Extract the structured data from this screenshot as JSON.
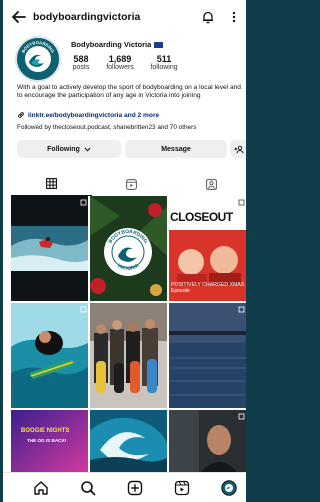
{
  "header": {
    "username": "bodyboardingvictoria",
    "icons": [
      "back-arrow-icon",
      "bell-icon",
      "more-icon"
    ]
  },
  "profile": {
    "name": "Bodyboarding Victoria",
    "flag": "australia-flag-icon",
    "avatar_text": [
      "BODYBOARDING",
      "VICTORIA"
    ],
    "stats": [
      {
        "value": "588",
        "label": "posts"
      },
      {
        "value": "1,689",
        "label": "followers"
      },
      {
        "value": "511",
        "label": "following"
      }
    ],
    "bio": "With a goal to actively develop the sport of bodyboarding on a local level and to encourage the participation of any age in Victoria into joining",
    "link": "linktr.ee/bodyboardingvictoria and 2 more",
    "followed_by": "Followed by thecloseout.podcast, shanebritten23 and 70 others"
  },
  "actions": {
    "following_label": "Following",
    "message_label": "Message"
  },
  "tabs": [
    "grid-icon",
    "reels-icon",
    "tagged-icon"
  ],
  "posts": {
    "tile_texts": {
      "closeout_title": "CLOSEOUT",
      "closeout_sub": "POSITIVELY CHARGED XMAS Episode",
      "logo_text": [
        "BODYBOARDING",
        "VICTORIA"
      ],
      "event_title": "BOOGIE NIGHTS",
      "event_sub": "THE OG IS BACK!"
    }
  },
  "bottom_nav": [
    "home-icon",
    "search-icon",
    "create-icon",
    "reels-nav-icon",
    "profile-avatar-icon"
  ],
  "colors": {
    "accent_teal": "#0e6170",
    "link_blue": "#0b2b6b",
    "button_bg": "#efefef",
    "backdrop": "#0f3d4a"
  }
}
